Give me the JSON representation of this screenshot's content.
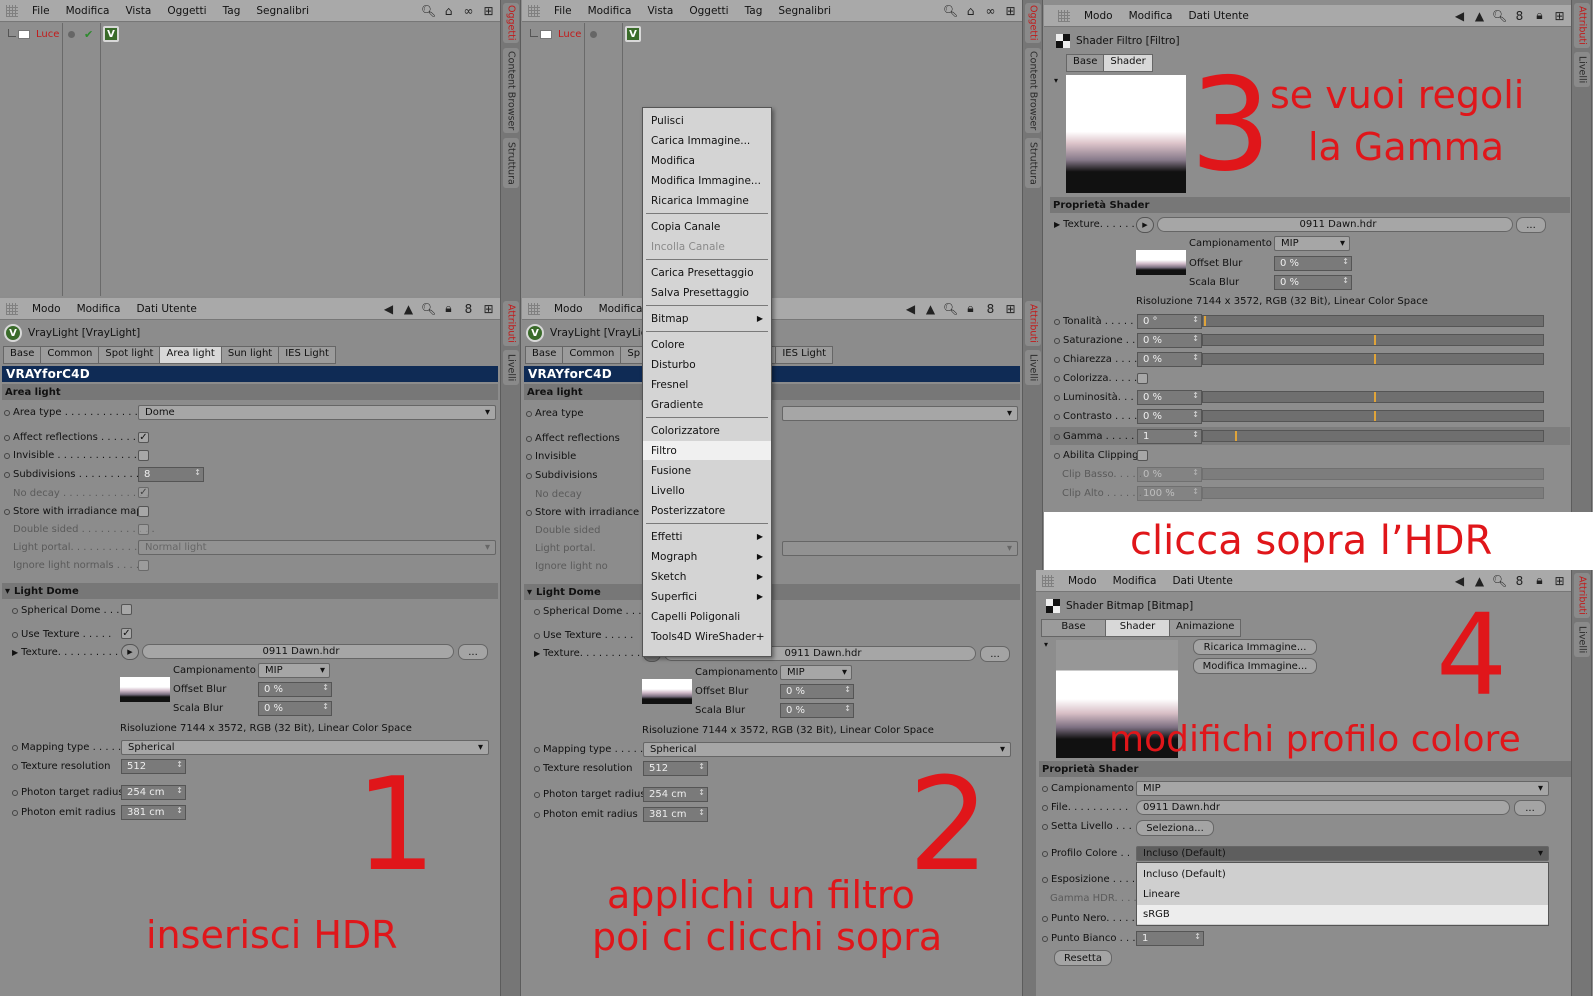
{
  "menus": {
    "om": [
      "File",
      "Modifica",
      "Vista",
      "Oggetti",
      "Tag",
      "Segnalibri"
    ],
    "am": [
      "Modo",
      "Modifica",
      "Dati Utente"
    ]
  },
  "side": {
    "tab1": "Oggetti",
    "tab2": "Content Browser",
    "tab3": "Struttura",
    "tab4": "Attributi",
    "tab5": "Livelli"
  },
  "obj": {
    "name": "Luce"
  },
  "p1": {
    "title": "VrayLight [VrayLight]",
    "tabs": [
      "Base",
      "Common",
      "Spot light",
      "Area light",
      "Sun light",
      "IES Light"
    ],
    "brand": "VRAYforC4D",
    "section": "Area light",
    "area_type_lbl": "Area type . . . . . . . . . . . . .",
    "area_type": "Dome",
    "affect": "Affect reflections . . . . . . .",
    "invisible": "Invisible . . . . . . . . . . . . . . .",
    "subdiv": "Subdivisions . . . . . . . . . . . .",
    "subdiv_val": "8",
    "nodecay": "No decay . . . . . . . . . . . . . .",
    "store": "Store with irradiance map",
    "double": "Double sided . . . . . . . . . . . .",
    "portal": "Light portal. . . . . . . . . . . . .",
    "portal_val": "Normal light",
    "ignore": "Ignore light normals . . . .",
    "dome": "Light Dome",
    "sph": "Spherical Dome . . .",
    "usetex": "Use Texture . . . . .",
    "texture": "Texture. . . . . . . . . . .",
    "texname": "0911 Dawn.hdr",
    "dots": "...",
    "camp": "Campionamento",
    "camp_val": "MIP",
    "offset": "Offset Blur",
    "offset_val": "0 %",
    "scala": "Scala Blur",
    "scala_val": "0 %",
    "risol": "Risoluzione 7144 x 3572, RGB (32 Bit), Linear Color Space",
    "mapping": "Mapping type . . . . .",
    "mapping_val": "Spherical",
    "texres": "Texture resolution",
    "texres_val": "512",
    "photon_t": "Photon target radius",
    "photon_t_val": "254 cm",
    "photon_e": "Photon emit radius",
    "photon_e_val": "381 cm"
  },
  "ctxmenu": [
    "Pulisci",
    "Carica Immagine...",
    "Modifica",
    "Modifica Immagine...",
    "Ricarica Immagine",
    "Copia Canale",
    "Incolla Canale",
    "Carica Presettaggio",
    "Salva Presettaggio",
    "Bitmap",
    "Colore",
    "Disturbo",
    "Fresnel",
    "Gradiente",
    "Colorizzatore",
    "Filtro",
    "Fusione",
    "Livello",
    "Posterizzatore",
    "Effetti",
    "Mograph",
    "Sketch",
    "Superfici",
    "Capelli Poligonali",
    "Tools4D WireShader+"
  ],
  "p3": {
    "title": "Shader Filtro [Filtro]",
    "tabs": [
      "Base",
      "Shader"
    ],
    "section": "Proprietà Shader",
    "texture": "Texture. . . . . .",
    "texname": "0911 Dawn.hdr",
    "rows": [
      "Tonalità . . . . . . .",
      "Saturazione . . . .",
      "Chiarezza . . . . . .",
      "Colorizza. . . . . .",
      "Luminosità. . . .",
      "Contrasto . . . . .",
      "Gamma . . . . . . .",
      "Abilita Clipping",
      "Clip Basso. . . . .",
      "Clip Alto . . . . . ."
    ],
    "vals": [
      "0 °",
      "0 %",
      "0 %",
      "",
      "0 %",
      "0 %",
      "1",
      "",
      "0 %",
      "100 %"
    ]
  },
  "p4": {
    "title": "Shader Bitmap [Bitmap]",
    "tabs": [
      "Base",
      "Shader",
      "Animazione"
    ],
    "ricarica": "Ricarica Immagine...",
    "modifica": "Modifica Immagine...",
    "section": "Proprietà Shader",
    "camp": "Campionamento",
    "camp_val": "MIP",
    "file": "File. . . . . . . . . .",
    "file_val": "0911 Dawn.hdr",
    "setta": "Setta Livello . . .",
    "seleziona": "Seleziona...",
    "profilo": "Profilo Colore . .",
    "profilo_val": "Incluso (Default)",
    "opts": [
      "Incluso (Default)",
      "Lineare",
      "sRGB"
    ],
    "espos": "Esposizione . . . .",
    "gamma": "Gamma HDR. . . .",
    "nero": "Punto Nero. . . . .",
    "bianco": "Punto Bianco . . .",
    "bianco_val": "1",
    "reset": "Resetta"
  },
  "ann": {
    "n1": "1",
    "t1": "inserisci HDR",
    "n2": "2",
    "t2a": "applichi un filtro",
    "t2b": "poi ci clicchi sopra",
    "n3": "3",
    "t3a": "se vuoi regoli",
    "t3b": "la Gamma",
    "click": "clicca sopra l’HDR",
    "n4": "4",
    "t4": "modifichi profilo colore"
  }
}
